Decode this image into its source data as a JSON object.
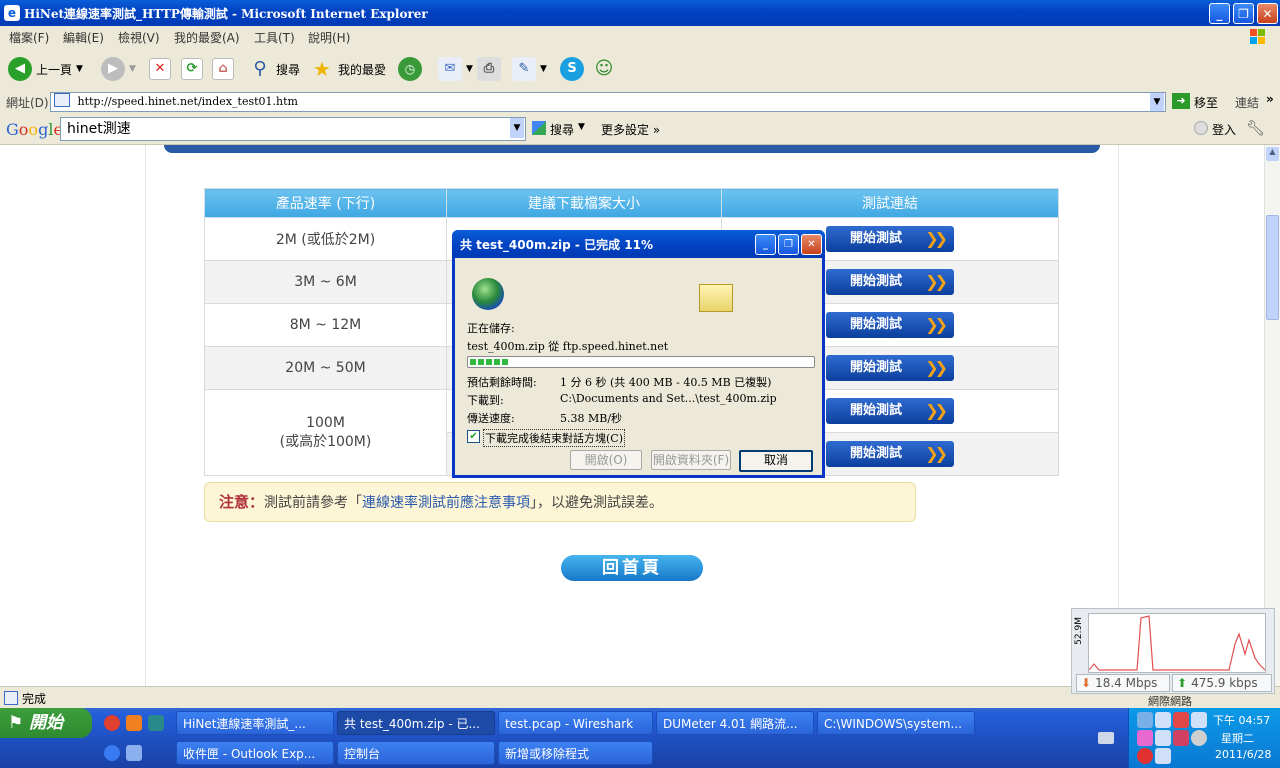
{
  "window": {
    "title": "HiNet連線速率測試_HTTP傳輸測試 - Microsoft Internet Explorer",
    "controls": [
      "_",
      "❐",
      "✕"
    ]
  },
  "menu": [
    "檔案(F)",
    "編輯(E)",
    "檢視(V)",
    "我的最愛(A)",
    "工具(T)",
    "說明(H)"
  ],
  "toolbar": {
    "back_label": "上一頁",
    "search_label": "搜尋",
    "favorites_label": "我的最愛"
  },
  "address": {
    "label": "網址(D)",
    "url": "http://speed.hinet.net/index_test01.htm",
    "go_label": "移至",
    "links_label": "連結"
  },
  "google": {
    "logo": "Google",
    "query": "hinet測速",
    "search_label": "搜尋",
    "more_label": "更多設定 »",
    "signin_label": "登入"
  },
  "table": {
    "headers": [
      "產品速率 (下行)",
      "建議下載檔案大小",
      "測試連結"
    ],
    "rows": [
      {
        "rate": "2M (或低於2M)",
        "button": "開始測試"
      },
      {
        "rate": "3M ~ 6M",
        "button": "開始測試"
      },
      {
        "rate": "8M ~ 12M",
        "button": "開始測試"
      },
      {
        "rate": "20M ~ 50M",
        "button": "開始測試"
      }
    ],
    "last_rate_line1": "100M",
    "last_rate_line2": "(或高於100M)",
    "last_buttons": [
      "開始測試",
      "開始測試"
    ]
  },
  "notice": {
    "label": "注意：",
    "prefix": "測試前請參考「",
    "link": "連線速率測試前應注意事項",
    "suffix": "」，以避免測試誤差。"
  },
  "home_button": "回首頁",
  "status": {
    "text": "完成"
  },
  "dialog": {
    "title": "共 test_400m.zip - 已完成 11%",
    "saving_label": "正在儲存:",
    "file_line": "test_400m.zip 從 ftp.speed.hinet.net",
    "progress_percent": 11,
    "eta_label": "預估剩餘時間:",
    "eta_value": "1 分 6 秒 (共 400 MB - 40.5 MB 已複製)",
    "dest_label": "下載到:",
    "dest_value": "C:\\Documents and Set...\\test_400m.zip",
    "rate_label": "傳送速度:",
    "rate_value": "5.38 MB/秒",
    "close_on_complete_label": "下載完成後結束對話方塊(C)",
    "close_on_complete_checked": true,
    "open_button": "開啟(O)",
    "open_folder_button": "開啟資料夾(F)",
    "cancel_button": "取消"
  },
  "dumeter": {
    "scale": "52.9M",
    "download": "18.4 Mbps",
    "upload": "475.9 kbps",
    "tooltip": "網際網路"
  },
  "taskbar": {
    "start_label": "開始",
    "tasks_row1": [
      "HiNet連線速率測試_...",
      "共 test_400m.zip - 已...",
      "test.pcap - Wireshark",
      "DUMeter 4.01 網路流...",
      "C:\\WINDOWS\\system..."
    ],
    "tasks_row2": [
      "收件匣 - Outlook Exp...",
      "控制台",
      "新增或移除程式"
    ],
    "clock_time": "下午 04:57",
    "clock_day": "星期二",
    "clock_date": "2011/6/28"
  }
}
